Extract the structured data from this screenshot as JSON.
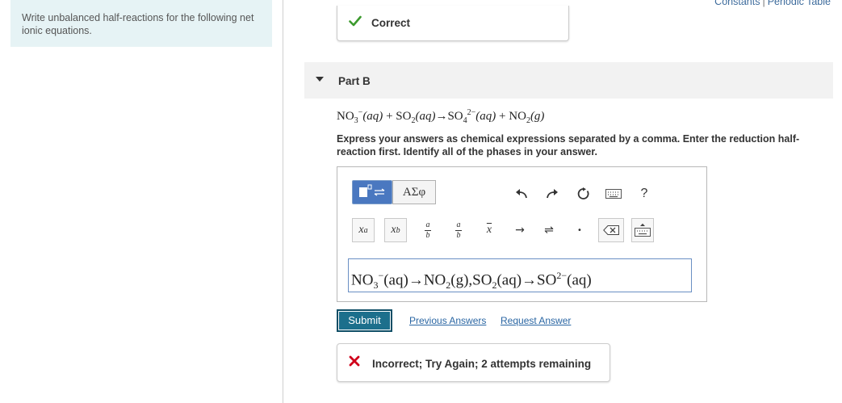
{
  "instructions": {
    "text": "Write unbalanced half-reactions for the following net ionic equations."
  },
  "top_links": {
    "constants": "Constants",
    "separator": "|",
    "periodic_table": "Periodic Table"
  },
  "previous_part": {
    "status": "Correct"
  },
  "part": {
    "label": "Part B"
  },
  "equation": {
    "r1": "NO",
    "r1_sub": "3",
    "r1_sup": "−",
    "r1_phase": "(aq)",
    "plus1": " + ",
    "r2": "SO",
    "r2_sub": "2",
    "r2_phase": "(aq)",
    "arrow": "→",
    "p1": "SO",
    "p1_sub": "4",
    "p1_sup": "2−",
    "p1_phase": "(aq)",
    "plus2": " + ",
    "p2": "NO",
    "p2_sub": "2",
    "p2_phase": "(g)"
  },
  "prompt": "Express your answers as chemical expressions separated by a comma. Enter the reduction half-reaction first. Identify all of the phases in your answer.",
  "toolbar": {
    "greek_label": "ΑΣφ",
    "help_label": "?",
    "superscript_base": "x",
    "superscript_exp": "a",
    "subscript_base": "x",
    "subscript_sub": "b",
    "frac_num": "a",
    "frac_den": "b",
    "vector_label": "x",
    "arrow_label": "→",
    "equilibrium_label": "⇌",
    "dot_label": "•"
  },
  "answer": {
    "t1": "NO",
    "t1_sub": "3",
    "t1_sup": "−",
    "t1_rest": "(aq)→NO",
    "t2_sub": "2",
    "t2_rest": "(g),SO",
    "t3_sub": "2",
    "t3_rest": "(aq)→SO",
    "t4_sup": "2−",
    "t4_rest": "(aq)"
  },
  "actions": {
    "submit": "Submit",
    "previous_answers": "Previous Answers",
    "request_answer": "Request Answer"
  },
  "feedback": {
    "incorrect": "Incorrect; Try Again; 2 attempts remaining"
  },
  "colors": {
    "correct": "#3c9a2e",
    "incorrect": "#d0021b",
    "submit_bg": "#1c6f8c",
    "link": "#2a66a3"
  }
}
